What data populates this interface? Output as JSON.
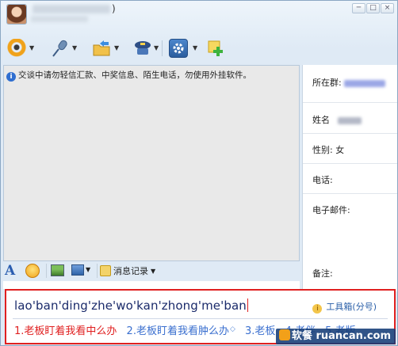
{
  "title": {
    "suffix": ")"
  },
  "window_controls": [
    "─",
    "□",
    "×"
  ],
  "toolbar": {
    "items": [
      {
        "icon": "webcam-icon",
        "has_dropdown": true
      },
      {
        "icon": "microphone-icon",
        "has_dropdown": true
      },
      {
        "icon": "folder-transfer-icon",
        "has_dropdown": true
      },
      {
        "icon": "remote-assist-icon",
        "has_dropdown": true
      },
      {
        "icon": "app-settings-icon",
        "has_dropdown": true
      },
      {
        "icon": "add-app-icon",
        "has_dropdown": false
      }
    ]
  },
  "chat": {
    "notice": "交谈中请勿轻信汇款、中奖信息、陌生电话，勿使用外挂软件。"
  },
  "profile": {
    "group_label": "所在群:",
    "name_label": "姓名",
    "gender_label": "性别:",
    "gender_value": "女",
    "phone_label": "电话:",
    "email_label": "电子邮件:",
    "remark_label": "备注:"
  },
  "format_bar": {
    "font_glyph": "A",
    "history_label": "消息记录"
  },
  "ime": {
    "composition": "lao'ban'ding'zhe'wo'kan'zhong'me'ban",
    "toolbox_label": "工具箱(分号)",
    "candidates": [
      "1.老板盯着我看中么办",
      "2.老板盯着我看肿么办",
      "3.老板",
      "4.老伴",
      "5.老版"
    ]
  },
  "watermark": {
    "text": "软餐 ruancan.com"
  },
  "colors": {
    "highlight_border": "#e02020",
    "first_candidate": "#e02020",
    "candidate": "#3a6fcf",
    "composition_text": "#1a2a6a",
    "chat_background": "#e9e9e9"
  }
}
